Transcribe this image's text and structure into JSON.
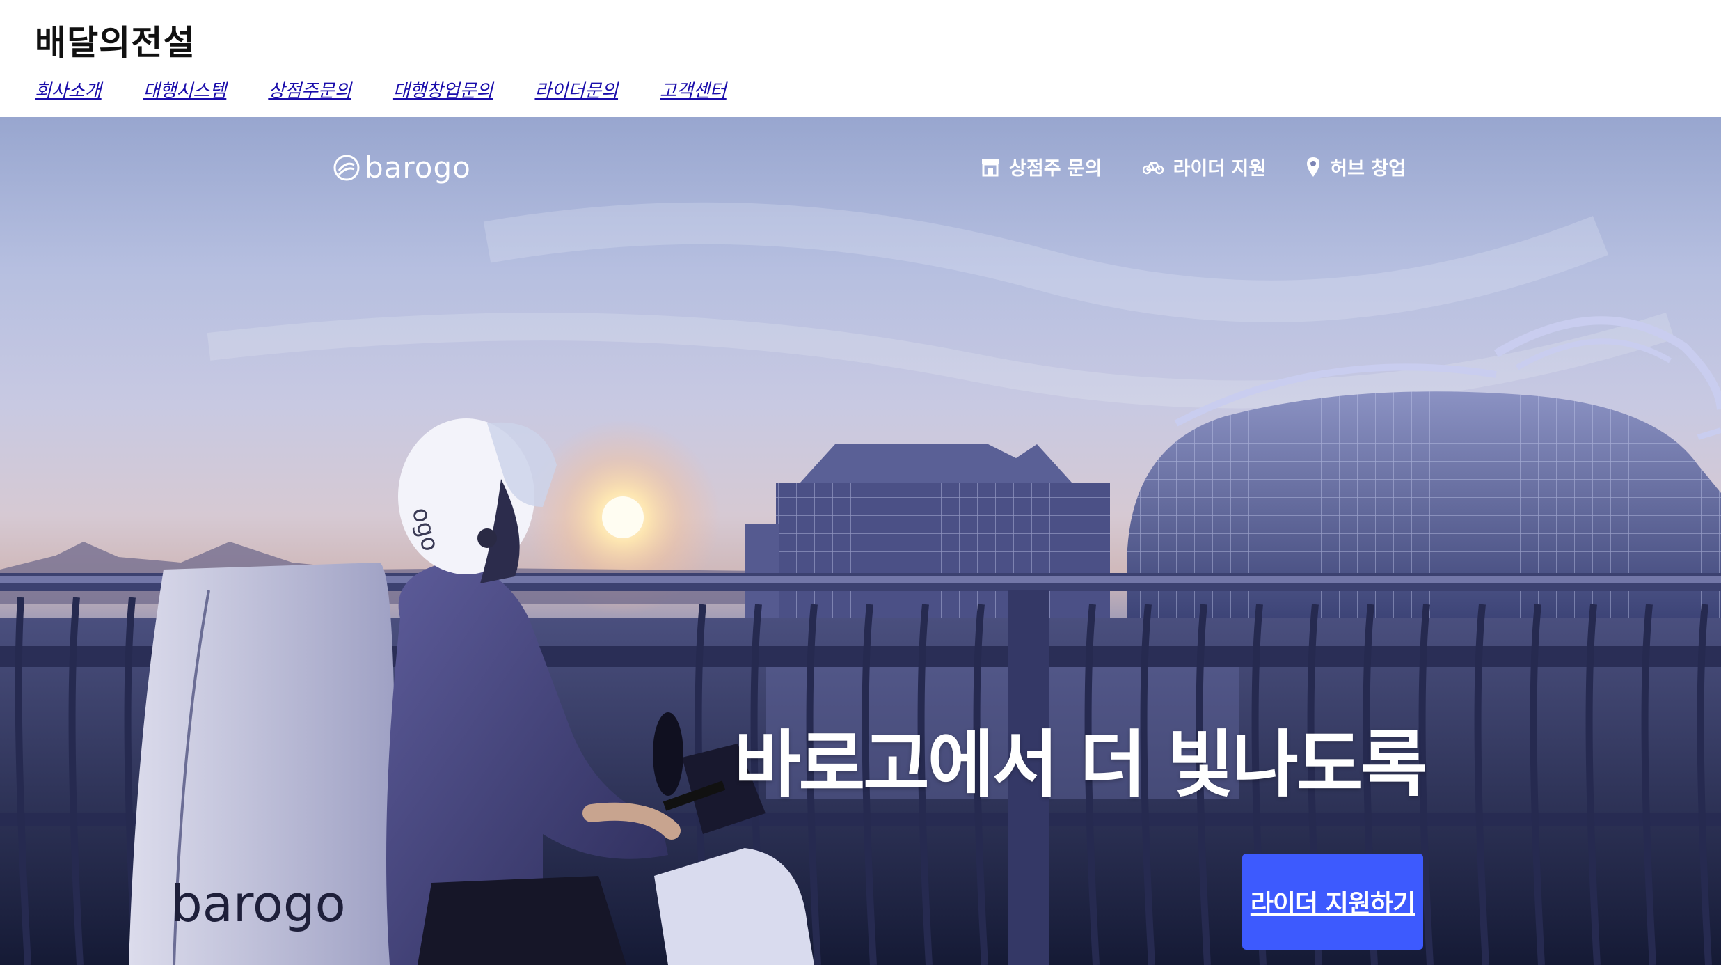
{
  "site": {
    "title": "배달의전설",
    "nav": [
      "회사소개",
      "대행시스템",
      "상점주문의",
      "대행창업문의",
      "라이더문의",
      "고객센터"
    ]
  },
  "hero": {
    "logo_text": "barogo",
    "nav": {
      "store_label": "상점주 문의",
      "rider_label": "라이더 지원",
      "hub_label": "허브 창업"
    },
    "headline": "바로고에서 더 빛나도록",
    "cta_label": "라이더 지원하기",
    "box_brand": "barogo",
    "helmet_brand": "ogo"
  },
  "colors": {
    "cta": "#3d5afe",
    "link": "#1a0dab"
  }
}
